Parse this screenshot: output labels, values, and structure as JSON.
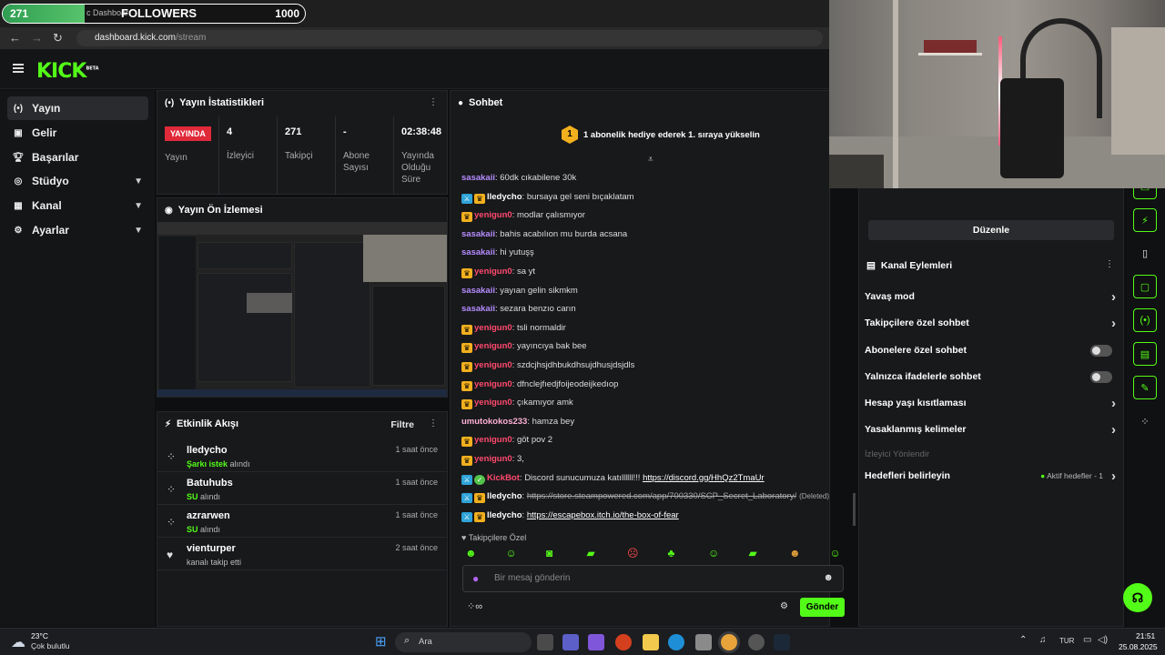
{
  "browser": {
    "follower_goal": {
      "current": "271",
      "label": "FOLLOWERS",
      "goal": "1000",
      "progress": 0.271,
      "tab_fragment": "c Dashboar"
    },
    "url_domain": "dashboard.kick.com",
    "url_path": "/stream"
  },
  "brand": {
    "logo": "KICK",
    "beta": "BETA",
    "accent": "#53fc18"
  },
  "sidebar": {
    "items": [
      {
        "label": "Yayın",
        "icon": "broadcast-icon"
      },
      {
        "label": "Gelir",
        "icon": "revenue-icon"
      },
      {
        "label": "Başarılar",
        "icon": "trophy-icon"
      },
      {
        "label": "Stüdyo",
        "icon": "studio-icon"
      },
      {
        "label": "Kanal",
        "icon": "channel-icon"
      },
      {
        "label": "Ayarlar",
        "icon": "settings-icon"
      }
    ]
  },
  "stats": {
    "title": "Yayın İstatistikleri",
    "live_badge": "YAYINDA",
    "live_label": "Yayın",
    "viewers": {
      "value": "4",
      "label": "İzleyici"
    },
    "followers": {
      "value": "271",
      "label": "Takipçi"
    },
    "subs": {
      "value": "-",
      "label": "Abone Sayısı"
    },
    "uptime": {
      "value": "02:38:48",
      "label": "Yayında Olduğu Süre"
    }
  },
  "preview": {
    "title": "Yayın Ön İzlemesi"
  },
  "activity": {
    "title": "Etkinlik Akışı",
    "filter": "Filtre",
    "items": [
      {
        "name": "lledycho",
        "action_hl": "Şarkı istek",
        "action": "alındı",
        "time": "1 saat önce"
      },
      {
        "name": "Batuhubs",
        "action_hl": "SU",
        "action": "alındı",
        "time": "1 saat önce"
      },
      {
        "name": "azrarwen",
        "action_hl": "SU",
        "action": "alındı",
        "time": "1 saat önce"
      },
      {
        "name": "vienturper",
        "action_hl": "",
        "action": "kanalı takip etti",
        "time": "2 saat önce"
      }
    ]
  },
  "chat": {
    "title": "Sohbet",
    "promo_rank": "1",
    "promo_text": "1 abonelik hediye ederek 1. sıraya yükselin",
    "messages": [
      {
        "user": "sasakaii",
        "text": "60dk cıkabilene 30k"
      },
      {
        "user": "lledycho",
        "text": "bursaya gel seni bıçaklatam"
      },
      {
        "user": "yenigun0",
        "text": "modlar çalısmıyor"
      },
      {
        "user": "sasakaii",
        "text": "bahis acabılıon mu burda acsana"
      },
      {
        "user": "sasakaii",
        "text": "hi yutuşş"
      },
      {
        "user": "yenigun0",
        "text": "sa yt"
      },
      {
        "user": "sasakaii",
        "text": "yayıan gelin sikmkm"
      },
      {
        "user": "sasakaii",
        "text": "sezara benzıo carın"
      },
      {
        "user": "yenigun0",
        "text": "tsli normaldir"
      },
      {
        "user": "yenigun0",
        "text": "yayıncıya bak bee"
      },
      {
        "user": "yenigun0",
        "text": "szdcjhsjdhbukdhsujdhusjdsjdls"
      },
      {
        "user": "yenigun0",
        "text": "dfnclejfıedjfoijeodeijkedıop"
      },
      {
        "user": "yenigun0",
        "text": "çıkamıyor amk"
      },
      {
        "user": "umutokokos233",
        "text": "hamza bey"
      },
      {
        "user": "yenigun0",
        "text": "göt pov 2"
      },
      {
        "user": "yenigun0",
        "text": "3,"
      },
      {
        "user": "KickBot",
        "text": "Discord sunucumuza katıllllll!!! ",
        "link": "https://discord.gg/HhQz2TmaUr"
      },
      {
        "user": "lledycho",
        "text": "",
        "link": "https://store.steampowered.com/app/700330/SCP_Secret_Laboratory/",
        "deleted": "(Deleted)"
      },
      {
        "user": "lledycho",
        "text": "",
        "link": "https://escapebox.itch.io/the-box-of-fear"
      }
    ],
    "followers_only": "Takipçilere Özel",
    "input_placeholder": "Bir mesaj gönderin",
    "send": "Gönder"
  },
  "actions": {
    "edit": "Düzenle",
    "title": "Kanal Eylemleri",
    "items": [
      {
        "label": "Yavaş mod",
        "type": "chevron"
      },
      {
        "label": "Takipçilere özel sohbet",
        "type": "chevron"
      },
      {
        "label": "Abonelere özel sohbet",
        "type": "toggle"
      },
      {
        "label": "Yalnızca ifadelerle sohbet",
        "type": "toggle"
      },
      {
        "label": "Hesap yaşı kısıtlaması",
        "type": "chevron"
      },
      {
        "label": "Yasaklanmış kelimeler",
        "type": "chevron"
      },
      {
        "label": "İzleyici Yönlendir",
        "type": "disabled"
      },
      {
        "label": "Hedefleri belirleyin",
        "type": "goal",
        "status": "Aktif hedefler - 1"
      }
    ]
  },
  "taskbar": {
    "weather_temp": "23°C",
    "weather_desc": "Çok bulutlu",
    "search": "Ara",
    "lang": "TUR",
    "time": "21:51",
    "date": "25.08.2025"
  }
}
